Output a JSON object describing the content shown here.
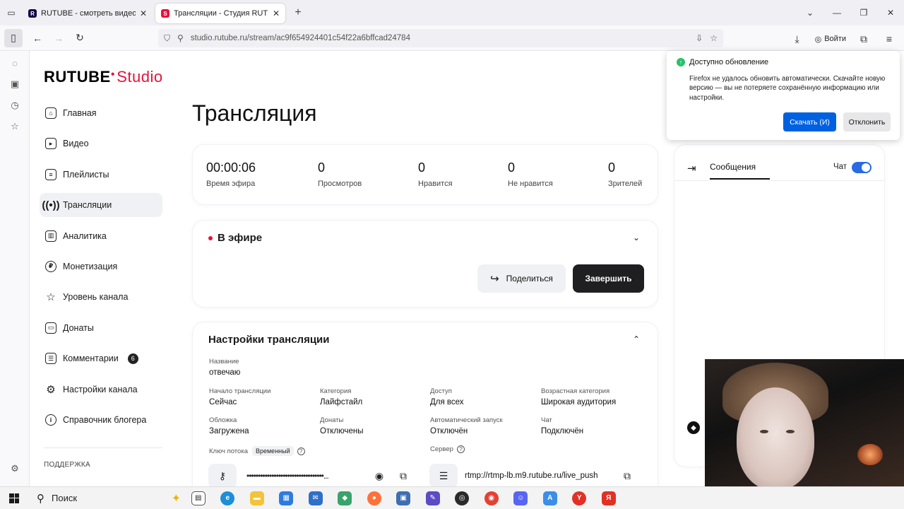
{
  "browser": {
    "tabs": [
      {
        "title": "RUTUBE - смотреть видео онл"
      },
      {
        "title": "Трансляции - Студия RUTUBE"
      }
    ],
    "url": "studio.rutube.ru/stream/ac9f654924401c54f22a6bffcad24784",
    "login_label": "Войти"
  },
  "app": {
    "logo_main": "RUTUBE",
    "logo_sub": "Studio",
    "menu": [
      {
        "label": "Главная",
        "icon": "home-icon"
      },
      {
        "label": "Видео",
        "icon": "video-icon"
      },
      {
        "label": "Плейлисты",
        "icon": "playlist-icon"
      },
      {
        "label": "Трансляции",
        "icon": "broadcast-icon",
        "active": true
      },
      {
        "label": "Аналитика",
        "icon": "analytics-icon"
      },
      {
        "label": "Монетизация",
        "icon": "ruble-icon"
      },
      {
        "label": "Уровень канала",
        "icon": "star-icon"
      },
      {
        "label": "Донаты",
        "icon": "wallet-icon"
      },
      {
        "label": "Комментарии",
        "icon": "comment-icon",
        "badge": "6"
      },
      {
        "label": "Настройки канала",
        "icon": "gear-icon"
      },
      {
        "label": "Справочник блогера",
        "icon": "info-icon"
      }
    ],
    "support_label": "ПОДДЕРЖКА"
  },
  "page": {
    "title": "Трансляция",
    "stats": [
      {
        "value": "00:00:06",
        "label": "Время эфира"
      },
      {
        "value": "0",
        "label": "Просмотров"
      },
      {
        "value": "0",
        "label": "Нравится"
      },
      {
        "value": "0",
        "label": "Не нравится"
      },
      {
        "value": "0",
        "label": "Зрителей"
      }
    ],
    "live": {
      "status": "В эфире",
      "share_label": "Поделиться",
      "finish_label": "Завершить"
    },
    "settings": {
      "title": "Настройки трансляции",
      "name_label": "Название",
      "name_value": "отвечаю",
      "fields": [
        {
          "label": "Начало трансляции",
          "value": "Сейчас"
        },
        {
          "label": "Категория",
          "value": "Лайфстайл"
        },
        {
          "label": "Доступ",
          "value": "Для всех"
        },
        {
          "label": "Возрастная категория",
          "value": "Широкая аудитория"
        },
        {
          "label": "Обложка",
          "value": "Загружена"
        },
        {
          "label": "Донаты",
          "value": "Отключены"
        },
        {
          "label": "Автоматический запуск",
          "value": "Отключён"
        },
        {
          "label": "Чат",
          "value": "Подключён"
        }
      ],
      "stream_key_label": "Ключ потока",
      "stream_key_tag": "Временный",
      "stream_key_value": "••••••••••••••••••••••••••••••••••...",
      "server_label": "Сервер",
      "server_value": "rtmp://rtmp-lb.m9.rutube.ru/live_push"
    },
    "chat": {
      "tab_label": "Сообщения",
      "toggle_label": "Чат",
      "toggle_on": true
    }
  },
  "update_popup": {
    "title": "Доступно обновление",
    "body": "Firefox не удалось обновить автоматически. Скачайте новую версию — вы не потеряете сохранённую информацию или настройки.",
    "download_label": "Скачать (И)",
    "dismiss_label": "Отклонить"
  },
  "taskbar": {
    "search_placeholder": "Поиск"
  },
  "colors": {
    "accent_red": "#e8113a",
    "toggle_blue": "#2a6be5",
    "firefox_blue": "#0061e0"
  }
}
